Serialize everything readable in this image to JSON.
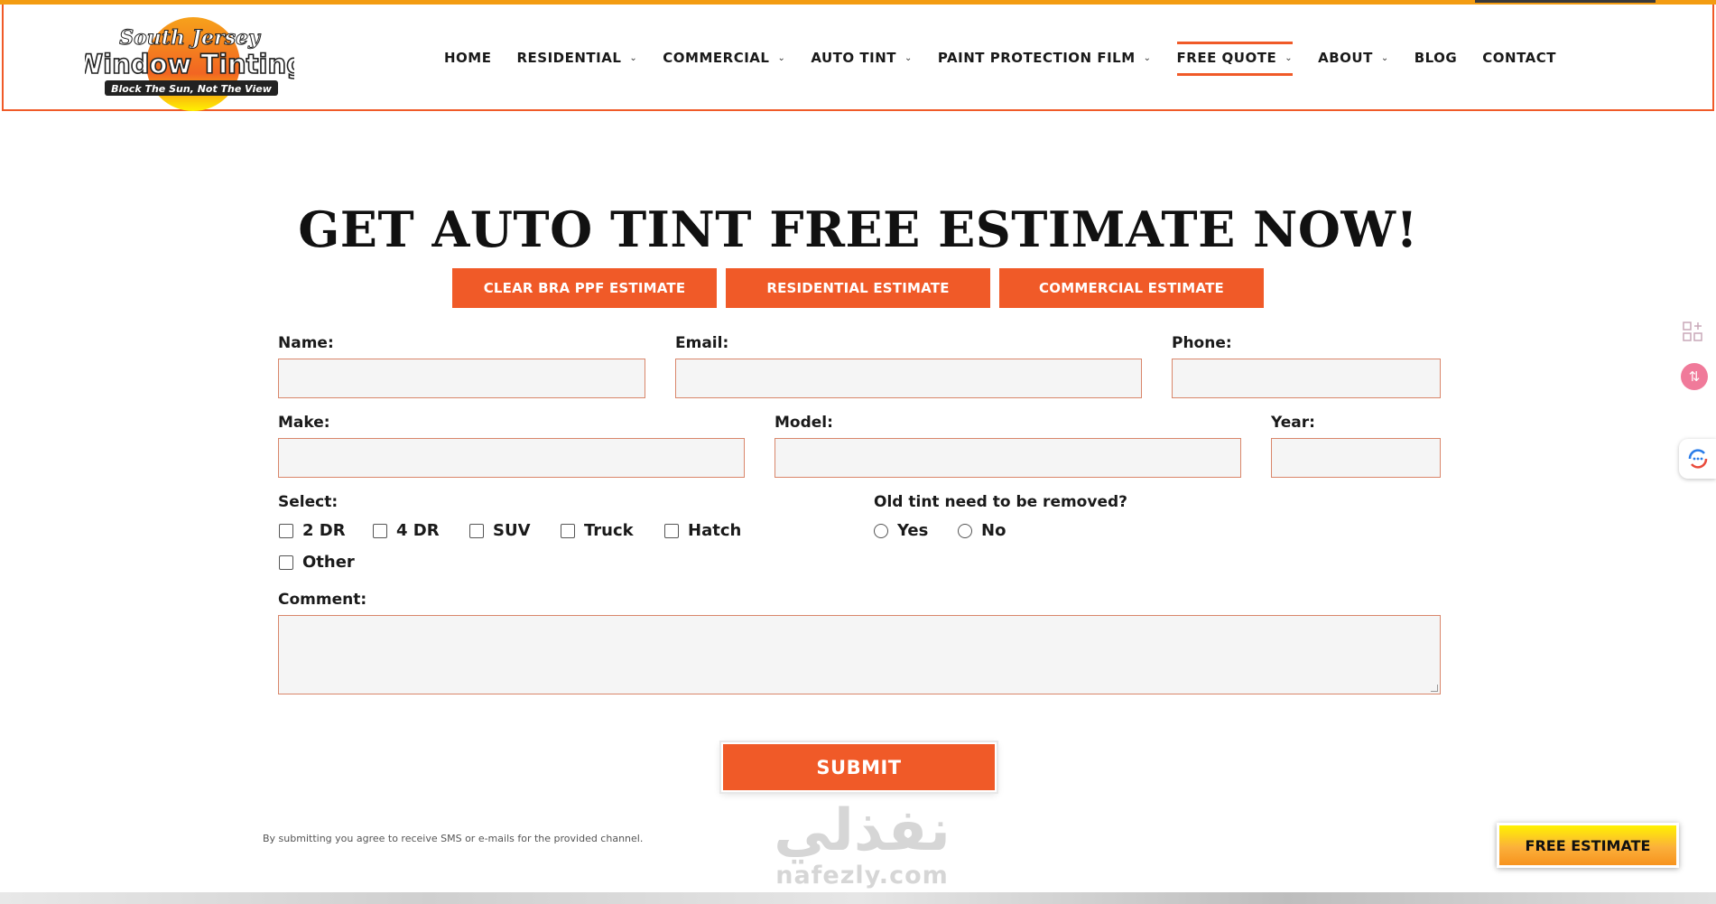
{
  "brand": {
    "logo_top": "South Jersey",
    "logo_main": "Window Tinting",
    "logo_tagline": "Block The Sun, Not The View",
    "accent": "#f05a28",
    "gold": "#f39c12"
  },
  "nav": {
    "items": [
      {
        "label": "HOME",
        "dropdown": false
      },
      {
        "label": "RESIDENTIAL",
        "dropdown": true
      },
      {
        "label": "COMMERCIAL",
        "dropdown": true
      },
      {
        "label": "AUTO TINT",
        "dropdown": true
      },
      {
        "label": "PAINT PROTECTION FILM",
        "dropdown": true
      },
      {
        "label": "FREE QUOTE",
        "dropdown": true,
        "active": true
      },
      {
        "label": "ABOUT",
        "dropdown": true
      },
      {
        "label": "BLOG",
        "dropdown": false
      },
      {
        "label": "CONTACT",
        "dropdown": false
      }
    ]
  },
  "page": {
    "title": "GET AUTO TINT FREE ESTIMATE NOW!",
    "estimate_buttons": [
      "CLEAR BRA PPF ESTIMATE",
      "RESIDENTIAL ESTIMATE",
      "COMMERCIAL ESTIMATE"
    ]
  },
  "form": {
    "name_label": "Name:",
    "email_label": "Email:",
    "phone_label": "Phone:",
    "make_label": "Make:",
    "model_label": "Model:",
    "year_label": "Year:",
    "select_label": "Select:",
    "vehicle_types": [
      "2 DR",
      "4 DR",
      "SUV",
      "Truck",
      "Hatch",
      "Other"
    ],
    "removal_label": "Old tint need to be removed?",
    "removal_options": [
      "Yes",
      "No"
    ],
    "comment_label": "Comment:",
    "submit_label": "SUBMIT",
    "disclaimer": "By submitting you agree to receive SMS or e-mails for the provided channel."
  },
  "watermark": {
    "arabic": "نفذلي",
    "latin": "nafezly.com"
  },
  "floating": {
    "free_estimate_label": "FREE ESTIMATE"
  }
}
